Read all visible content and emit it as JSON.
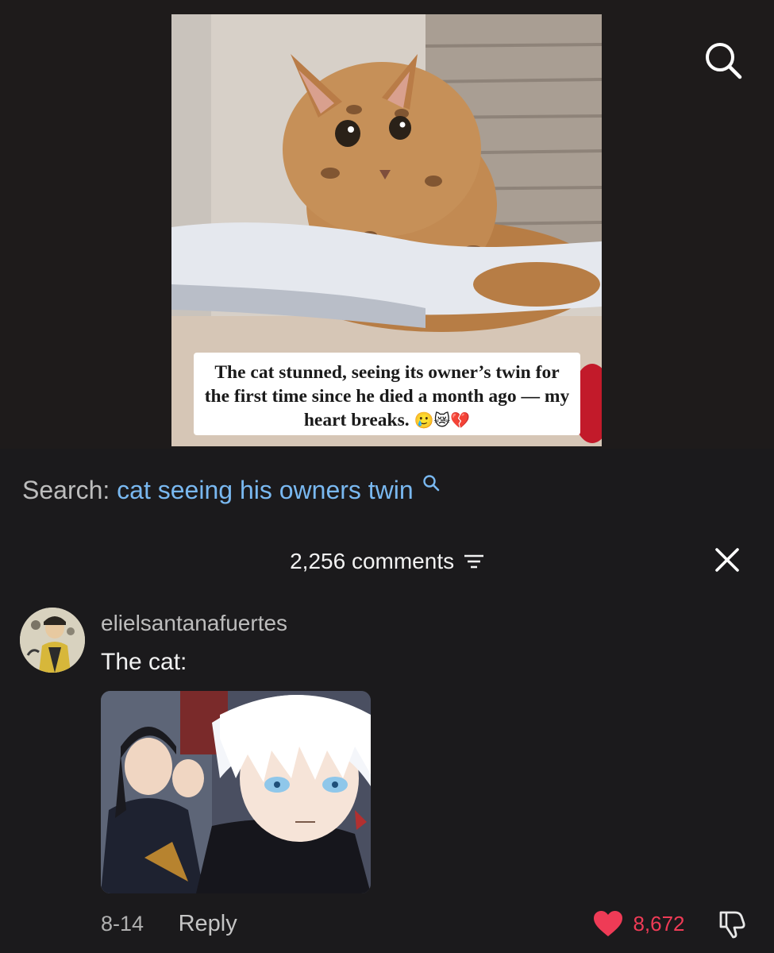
{
  "video": {
    "caption": "The cat stunned, seeing its owner’s twin for the first time since he died a month ago — my heart breaks.",
    "caption_emojis": "🥲😿💔"
  },
  "search": {
    "prefix": "Search:",
    "query": "cat seeing his owners twin"
  },
  "comments_header": {
    "count_label": "2,256 comments"
  },
  "comment": {
    "username": "elielsantanafuertes",
    "text": "The cat:",
    "date": "8-14",
    "reply_label": "Reply",
    "like_count": "8,672"
  },
  "colors": {
    "background": "#1b1a1c",
    "search_query": "#79b8f0",
    "like": "#ef3b56",
    "muted_text": "#bdbdbd"
  },
  "icons": [
    "search-icon",
    "sort-icon",
    "close-icon",
    "heart-icon",
    "dislike-icon"
  ]
}
